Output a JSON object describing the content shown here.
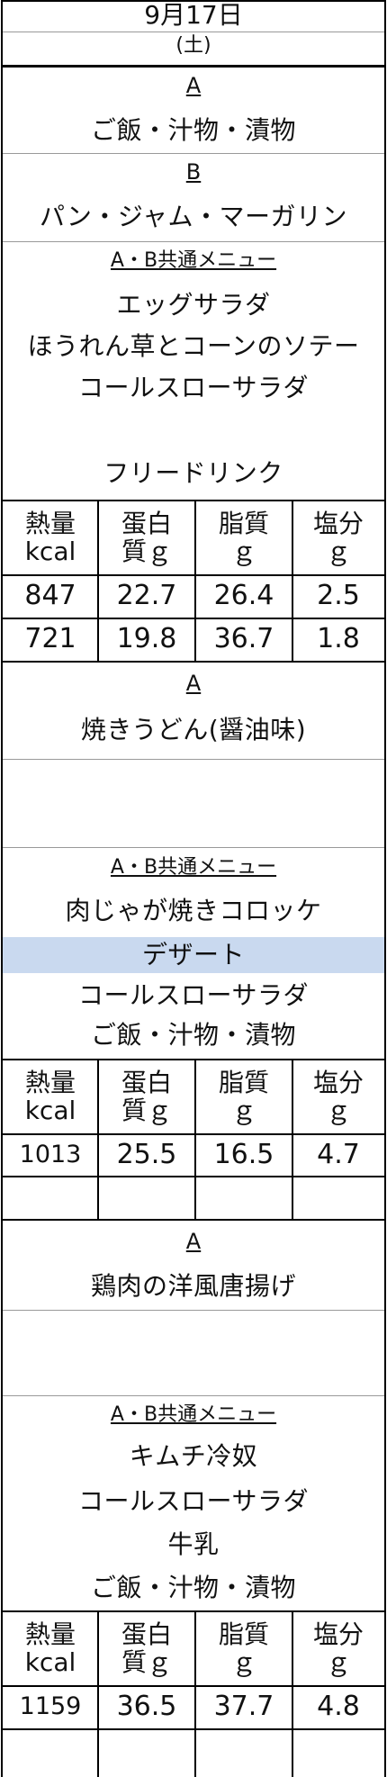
{
  "header": {
    "date": "9月17日",
    "day": "(土)"
  },
  "sections": [
    {
      "option_a": {
        "label": "A",
        "item": "ご飯・汁物・漬物"
      },
      "option_b": {
        "label": "B",
        "item": "パン・ジャム・マーガリン"
      },
      "common": {
        "label": "A・B共通メニュー",
        "items": [
          "エッグサラダ",
          "ほうれん草とコーンのソテー",
          "コールスローサラダ",
          "",
          "フリードリンク"
        ]
      },
      "nutrition_headers": [
        "熱量\nkcal",
        "蛋白\n質ｇ",
        "脂質\nｇ",
        "塩分\nｇ"
      ],
      "nutrition_rows": [
        [
          "847",
          "22.7",
          "26.4",
          "2.5"
        ],
        [
          "721",
          "19.8",
          "36.7",
          "1.8"
        ]
      ]
    },
    {
      "option_a": {
        "label": "A",
        "item": "焼きうどん(醤油味)"
      },
      "common": {
        "label": "A・B共通メニュー",
        "items": [
          "肉じゃが焼きコロッケ",
          "デザート",
          "コールスローサラダ",
          "ご飯・汁物・漬物"
        ],
        "highlight_color": "#c9d9ef"
      },
      "nutrition_headers": [
        "熱量\nkcal",
        "蛋白\n質ｇ",
        "脂質\nｇ",
        "塩分\nｇ"
      ],
      "nutrition_rows": [
        [
          "1013",
          "25.5",
          "16.5",
          "4.7"
        ],
        [
          "",
          "",
          "",
          ""
        ]
      ]
    },
    {
      "option_a": {
        "label": "A",
        "item": "鶏肉の洋風唐揚げ"
      },
      "common": {
        "label": "A・B共通メニュー",
        "items": [
          "キムチ冷奴",
          "コールスローサラダ",
          "牛乳",
          "ご飯・汁物・漬物"
        ]
      },
      "nutrition_headers": [
        "熱量\nkcal",
        "蛋白\n質ｇ",
        "脂質\nｇ",
        "塩分\nｇ"
      ],
      "nutrition_rows": [
        [
          "1159",
          "36.5",
          "37.7",
          "4.8"
        ],
        [
          "",
          "",
          "",
          ""
        ]
      ]
    }
  ]
}
